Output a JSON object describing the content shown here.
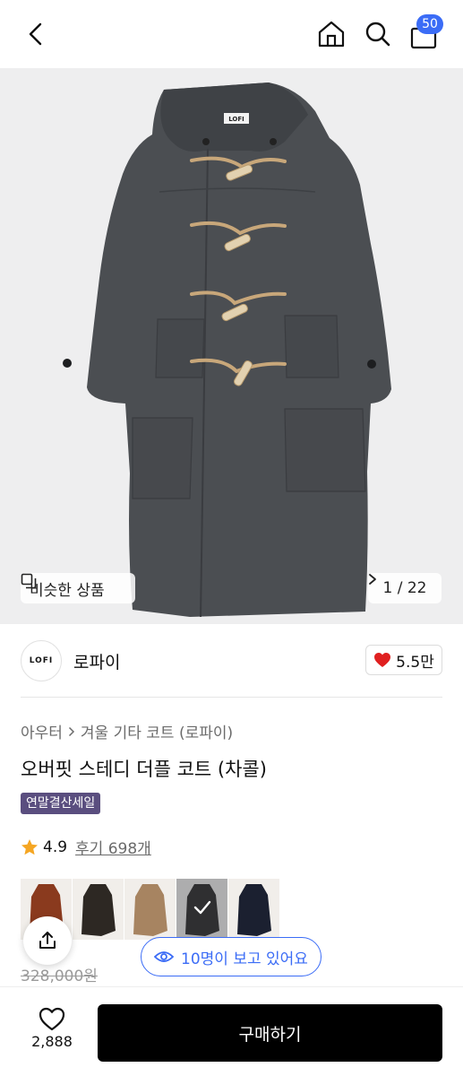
{
  "header": {
    "cart_count": "50",
    "icons": [
      "back-icon",
      "home-icon",
      "search-icon",
      "cart-icon"
    ]
  },
  "hero": {
    "coat_label": "LOFI",
    "similar_label": "비슷한 상품",
    "counter": "1 / 22"
  },
  "brand": {
    "logo_text": "LOFI",
    "name": "로파이",
    "likes": "5.5만"
  },
  "product": {
    "breadcrumb": [
      "아우터",
      "겨울 기타 코트 (로파이)"
    ],
    "title": "오버핏 스테디 더플 코트 (차콜)",
    "badge": "연말결산세일",
    "rating": "4.9",
    "reviews": "후기 698개",
    "colors": [
      "#8a3a1e",
      "#2d2823",
      "#a78461",
      "#3f3f42",
      "#1b2030"
    ],
    "selected_color_index": 3,
    "original_price": "328,000원"
  },
  "floating": {
    "viewers": "10명이 보고 있어요"
  },
  "bottom": {
    "wish_count": "2,888",
    "buy_label": "구매하기"
  },
  "colors": {
    "accent": "#3b6cf6",
    "heart": "#e02020",
    "badge_bg": "#5a4e7f",
    "buy_bg": "#000000"
  }
}
